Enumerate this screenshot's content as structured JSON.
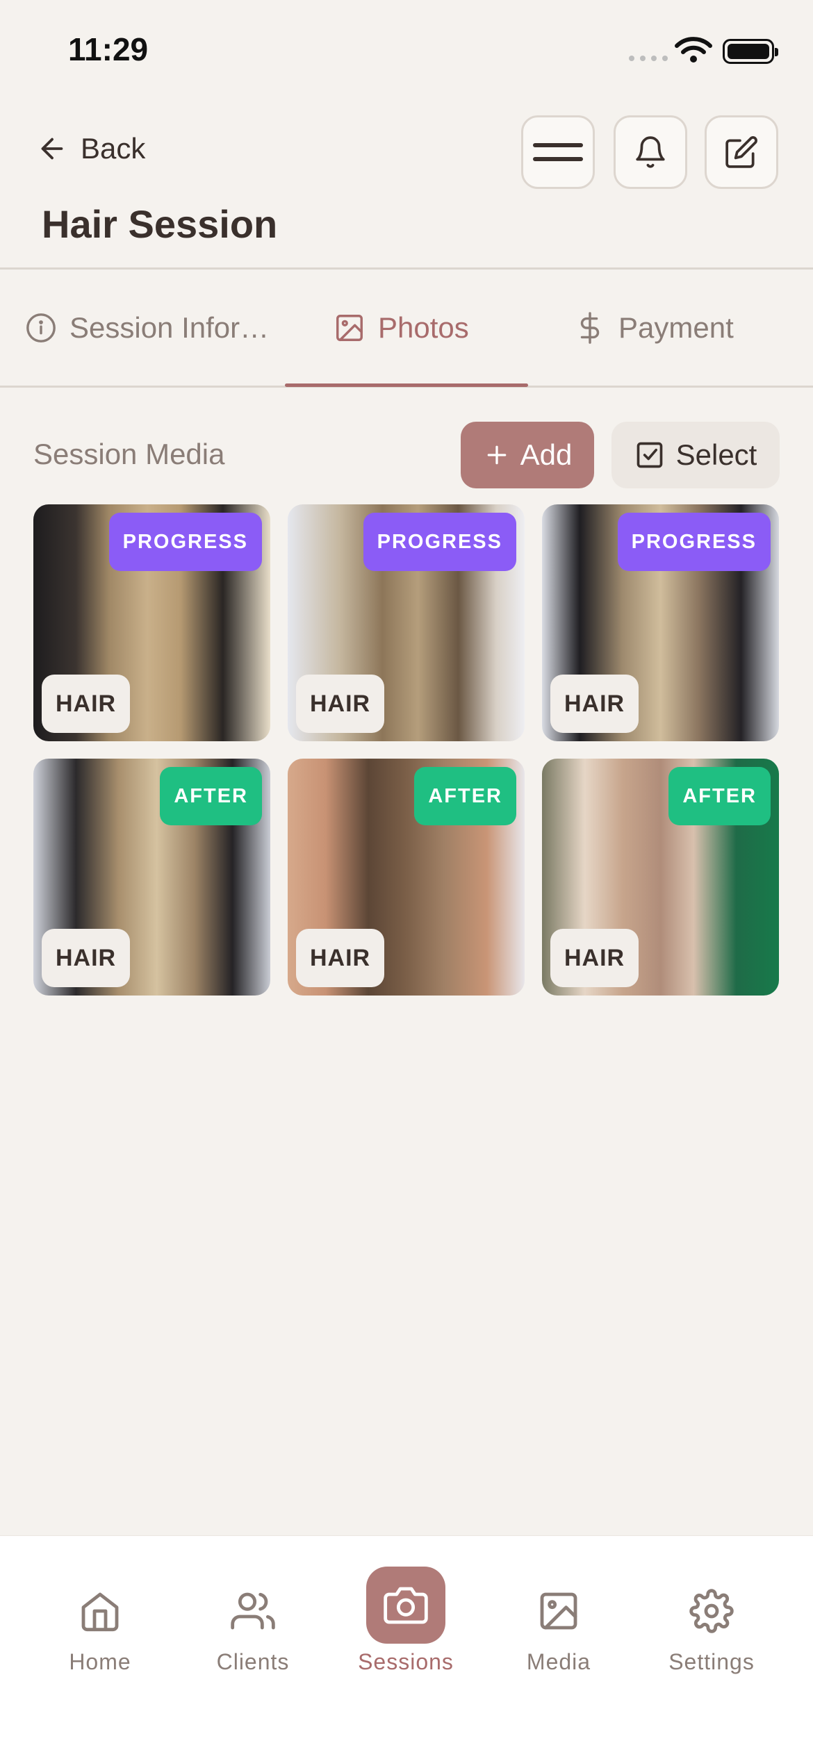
{
  "status_bar": {
    "time": "11:29"
  },
  "header": {
    "back_label": "Back",
    "title": "Hair Session"
  },
  "tabs": [
    {
      "label": "Session Infor…",
      "icon": "info-icon",
      "active": false
    },
    {
      "label": "Photos",
      "icon": "image-icon",
      "active": true
    },
    {
      "label": "Payment",
      "icon": "dollar-icon",
      "active": false
    }
  ],
  "media_section": {
    "label": "Session Media",
    "add_label": "Add",
    "select_label": "Select",
    "items": [
      {
        "stage": "PROGRESS",
        "category": "HAIR"
      },
      {
        "stage": "PROGRESS",
        "category": "HAIR"
      },
      {
        "stage": "PROGRESS",
        "category": "HAIR"
      },
      {
        "stage": "AFTER",
        "category": "HAIR"
      },
      {
        "stage": "AFTER",
        "category": "HAIR"
      },
      {
        "stage": "AFTER",
        "category": "HAIR"
      }
    ]
  },
  "bottom_nav": [
    {
      "label": "Home",
      "icon": "home-icon"
    },
    {
      "label": "Clients",
      "icon": "users-icon"
    },
    {
      "label": "Sessions",
      "icon": "camera-icon",
      "active": true
    },
    {
      "label": "Media",
      "icon": "image-icon"
    },
    {
      "label": "Settings",
      "icon": "gear-icon"
    }
  ],
  "colors": {
    "background": "#f5f2ee",
    "accent": "#b07b78",
    "progress": "#8b5cf6",
    "after": "#1fbf82"
  }
}
